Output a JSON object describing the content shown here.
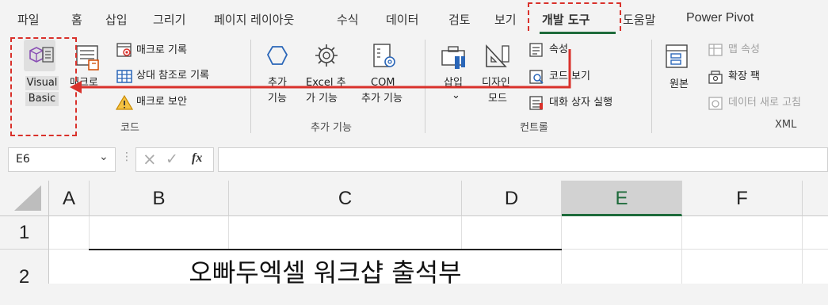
{
  "tabs": {
    "file": "파일",
    "home": "홈",
    "insert": "삽입",
    "draw": "그리기",
    "page_layout": "페이지 레이아웃",
    "formulas": "수식",
    "data": "데이터",
    "review": "검토",
    "view": "보기",
    "developer": "개발 도구",
    "help": "도움말",
    "power_pivot": "Power Pivot"
  },
  "ribbon": {
    "code": {
      "visual_basic_line1": "Visual",
      "visual_basic_line2": "Basic",
      "macros": "매크로",
      "record_macro": "매크로 기록",
      "relative_refs": "상대 참조로 기록",
      "macro_security": "매크로 보안",
      "group_label": "코드"
    },
    "addins": {
      "addins_line1": "추가",
      "addins_line2": "기능",
      "excel_addins_line1": "Excel 추",
      "excel_addins_line2": "가 기능",
      "com_addins_line1": "COM",
      "com_addins_line2": "추가 기능",
      "group_label": "추가 기능"
    },
    "controls": {
      "insert": "삽입",
      "insert_chevron": "⌄",
      "design_mode_line1": "디자인",
      "design_mode_line2": "모드",
      "properties": "속성",
      "view_code": "코드 보기",
      "run_dialog": "대화 상자 실행",
      "group_label": "컨트롤"
    },
    "xml": {
      "source": "원본",
      "map_properties": "맵 속성",
      "expansion_packs": "확장 팩",
      "refresh_data": "데이터 새로 고침",
      "group_label": "XML"
    }
  },
  "formula_bar": {
    "name_box": "E6",
    "cancel_icon": "×",
    "enter_icon": "✓",
    "fx": "fx",
    "formula_value": ""
  },
  "sheet": {
    "columns": [
      "A",
      "B",
      "C",
      "D",
      "E",
      "F"
    ],
    "rows": [
      "1",
      "2"
    ],
    "selected_column": "E",
    "title_text": "오빠두엑셀 워크샵 출석부"
  },
  "colors": {
    "accent_green": "#1e6b3b",
    "annotation_red": "#d9312b"
  }
}
